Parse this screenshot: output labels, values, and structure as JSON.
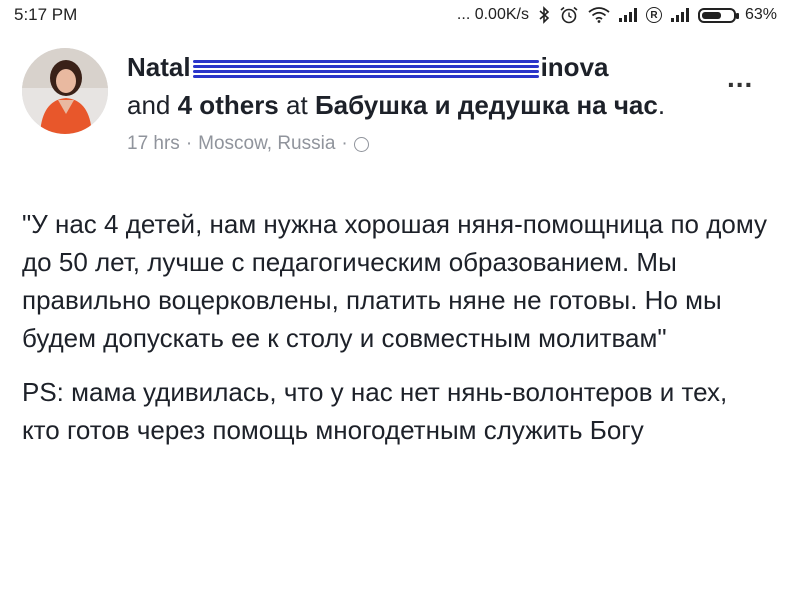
{
  "status_bar": {
    "time": "5:17 PM",
    "network_speed": "... 0.00K/s",
    "battery_percent": "63%",
    "battery_level": 0.63
  },
  "post": {
    "author_first": "Natal",
    "author_last": "inova",
    "and_text": "and",
    "others_text": "4 others",
    "at_text": "at",
    "place": "Бабушка и дедушка на час",
    "period": ".",
    "time_ago": "17 hrs",
    "separator": "·",
    "location": "Moscow, Russia",
    "more_label": "...",
    "body_quote": "\"У нас 4 детей, нам нужна хорошая няня-помощница по дому до 50 лет, лучше с педагогическим образованием. Мы правильно воцерковлены, платить няне не готовы. Но мы будем допускать ее к столу и совместным молитвам\"",
    "body_ps": "PS: мама удивилась, что у нас нет нянь-волонтеров и тех, кто готов через помощь многодетным служить Богу"
  },
  "icons": [
    "bluetooth-icon",
    "alarm-icon",
    "wifi-icon",
    "signal-icon",
    "registered-icon",
    "battery-icon",
    "globe-icon",
    "avatar"
  ]
}
